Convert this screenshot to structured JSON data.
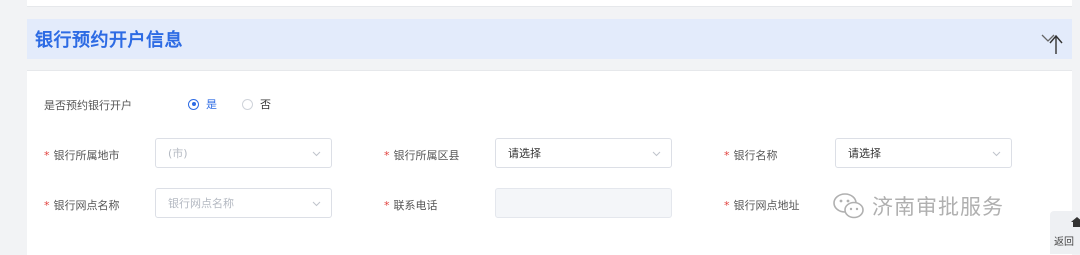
{
  "section": {
    "title": "银行预约开户信息",
    "collapse_icon": "collapse-arrow-icon"
  },
  "form": {
    "reserve_label": "是否预约银行开户",
    "radio_yes": "是",
    "radio_no": "否",
    "selected": "是",
    "required_mark": "*",
    "city_label": "银行所属地市",
    "city_value": "(市)",
    "district_label": "银行所属区县",
    "district_value": "请选择",
    "bank_name_label": "银行名称",
    "bank_name_value": "请选择",
    "branch_name_label": "银行网点名称",
    "branch_name_placeholder": "银行网点名称",
    "phone_label": "联系电话",
    "phone_value": "",
    "branch_address_label": "银行网点地址"
  },
  "watermark": {
    "text": "济南审批服务",
    "icon": "wechat-icon"
  },
  "back_to_top": {
    "label": "返回",
    "icon": "home-arrow-icon"
  },
  "colors": {
    "accent": "#2d6be4",
    "header_bg": "#e3ebfb",
    "required": "#e2413d"
  }
}
